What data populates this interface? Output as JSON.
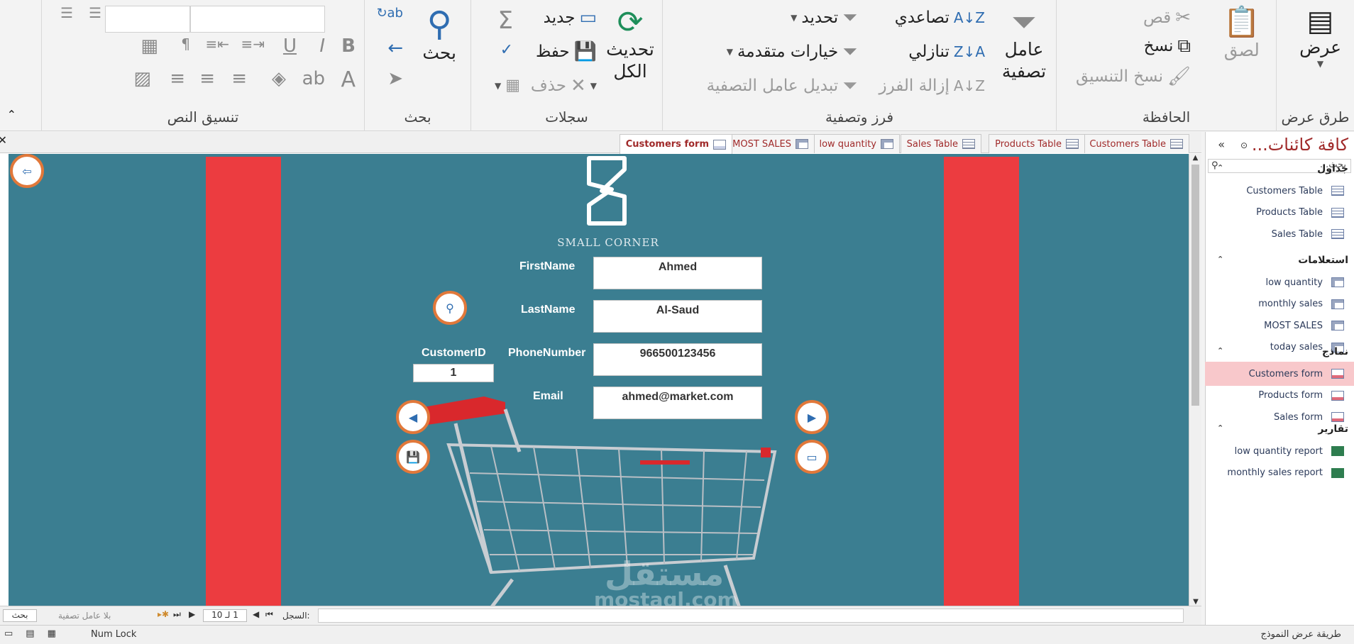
{
  "ribbon": {
    "views": {
      "view": "عرض",
      "group": "طرق عرض"
    },
    "clipboard": {
      "paste": "لصق",
      "cut": "قص",
      "copy": "نسخ",
      "format_painter": "نسخ التنسيق",
      "group": "الحافظة"
    },
    "sort_filter": {
      "filter": "عامل تصفية",
      "ascending": "تصاعدي",
      "descending": "تنازلي",
      "remove_sort": "إزالة الفرز",
      "selection": "تحديد",
      "advanced": "خيارات متقدمة",
      "toggle_filter": "تبديل عامل التصفية",
      "group": "فرز وتصفية"
    },
    "records": {
      "refresh_all": "تحديث الكل",
      "new": "جديد",
      "save": "حفظ",
      "delete": "حذف",
      "group": "سجلات"
    },
    "find": {
      "find": "بحث",
      "group": "بحث"
    },
    "text_format": {
      "group": "تنسيق النص",
      "font_value": "",
      "size_value": ""
    }
  },
  "tabs": [
    "Customers form",
    "MOST SALES",
    "low quantity",
    "Sales Table",
    "Products Table",
    "Customers Table"
  ],
  "active_tab": "Customers form",
  "form": {
    "logo_text": "SMALL CORNER",
    "labels": {
      "first": "FirstName",
      "last": "LastName",
      "phone": "PhoneNumber",
      "email": "Email",
      "cid": "CustomerID"
    },
    "values": {
      "first": "Ahmed",
      "last": "Al-Saud",
      "phone": "966500123456",
      "email": "ahmed@market.com",
      "cid": "1"
    }
  },
  "navbar": {
    "record_label": "السجل:",
    "record_value": "1 لـ 10",
    "filter_status": "بلا عامل تصفية",
    "search": "بحث"
  },
  "statusbar": {
    "mode": "طريقة عرض النموذج",
    "numlock": "Num Lock"
  },
  "pane": {
    "title": "كافة كائنات...",
    "search_placeholder": "بحث...",
    "sections": [
      {
        "name": "جداول",
        "items": [
          "Customers Table",
          "Products Table",
          "Sales Table"
        ]
      },
      {
        "name": "استعلامات",
        "items": [
          "low quantity",
          "monthly sales",
          "MOST SALES",
          "today sales"
        ]
      },
      {
        "name": "نماذج",
        "items": [
          "Customers form",
          "Products form",
          "Sales form"
        ]
      },
      {
        "name": "تقارير",
        "items": [
          "low quantity report",
          "monthly sales report"
        ]
      }
    ],
    "selected": "Customers form"
  },
  "watermark": {
    "arabic": "مستقل",
    "latin": "mostaql.com"
  },
  "colors": {
    "form_bg": "#3b7e91",
    "stripe": "#ec3c40",
    "button_ring": "#e1783a",
    "tab_text": "#a02a2a"
  }
}
